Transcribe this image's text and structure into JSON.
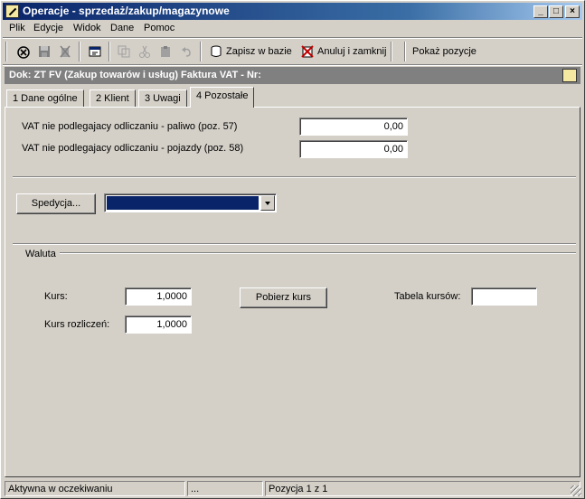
{
  "window": {
    "title": "Operacje - sprzedaż/zakup/magazynowe",
    "minimize": "_",
    "maximize": "□",
    "close": "×"
  },
  "menu": [
    {
      "label": "Plik"
    },
    {
      "label": "Edycje"
    },
    {
      "label": "Widok"
    },
    {
      "label": "Dane"
    },
    {
      "label": "Pomoc"
    }
  ],
  "toolbar": {
    "save_label": "Zapisz w bazie",
    "cancel_label": "Anuluj i zamknij",
    "show_label": "Pokaż pozycje"
  },
  "doc_header": "Dok: ZT FV (Zakup towarów i usług)  Faktura VAT  -  Nr:",
  "tabs": [
    {
      "label": "1 Dane ogólne"
    },
    {
      "label": "2 Klient"
    },
    {
      "label": "3 Uwagi"
    },
    {
      "label": "4 Pozostałe"
    }
  ],
  "vat": {
    "fuel_label": "VAT nie podlegajacy odliczaniu - paliwo (poz. 57)",
    "fuel_value": "0,00",
    "vehicles_label": "VAT nie podlegajacy odliczaniu - pojazdy (poz. 58)",
    "vehicles_value": "0,00"
  },
  "spedycja": {
    "button_label": "Spedycja..."
  },
  "waluta": {
    "group_label": "Waluta",
    "kurs_label": "Kurs:",
    "kurs_value": "1,0000",
    "kurs_rozl_label": "Kurs rozliczeń:",
    "kurs_rozl_value": "1,0000",
    "pobierz_label": "Pobierz kurs",
    "tabela_label": "Tabela kursów:",
    "tabela_value": ""
  },
  "status": {
    "state": "Aktywna w oczekiwaniu",
    "middle": "...",
    "position": "Pozycja 1 z 1"
  }
}
